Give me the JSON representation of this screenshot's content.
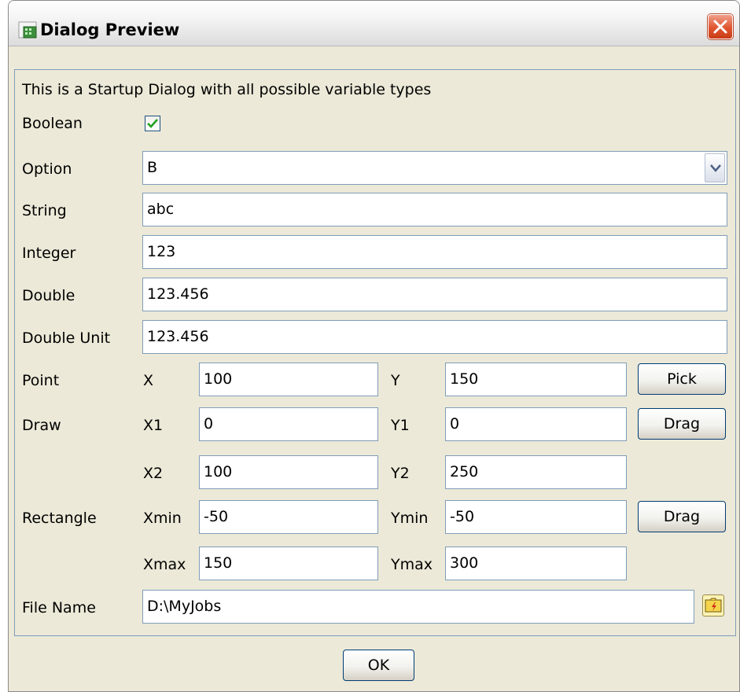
{
  "window": {
    "title": "Dialog Preview"
  },
  "description": "This is a Startup Dialog with all possible variable types",
  "boolean": {
    "label": "Boolean",
    "checked": true
  },
  "option": {
    "label": "Option",
    "value": "B"
  },
  "string": {
    "label": "String",
    "value": "abc"
  },
  "integer": {
    "label": "Integer",
    "value": "123"
  },
  "double": {
    "label": "Double",
    "value": "123.456"
  },
  "double_unit": {
    "label": "Double Unit",
    "value": "123.456"
  },
  "point": {
    "label": "Point",
    "x_label": "X",
    "x_value": "100",
    "y_label": "Y",
    "y_value": "150",
    "button": "Pick"
  },
  "draw": {
    "label": "Draw",
    "x1_label": "X1",
    "x1_value": "0",
    "y1_label": "Y1",
    "y1_value": "0",
    "x2_label": "X2",
    "x2_value": "100",
    "y2_label": "Y2",
    "y2_value": "250",
    "button": "Drag"
  },
  "rectangle": {
    "label": "Rectangle",
    "xmin_label": "Xmin",
    "xmin_value": "-50",
    "ymin_label": "Ymin",
    "ymin_value": "-50",
    "xmax_label": "Xmax",
    "xmax_value": "150",
    "ymax_label": "Ymax",
    "ymax_value": "300",
    "button": "Drag"
  },
  "file_name": {
    "label": "File Name",
    "value": "D:\\MyJobs"
  },
  "ok_button": "OK",
  "colors": {
    "field_border": "#7f9db9",
    "background": "#ece9d8",
    "check": "#21a121"
  }
}
